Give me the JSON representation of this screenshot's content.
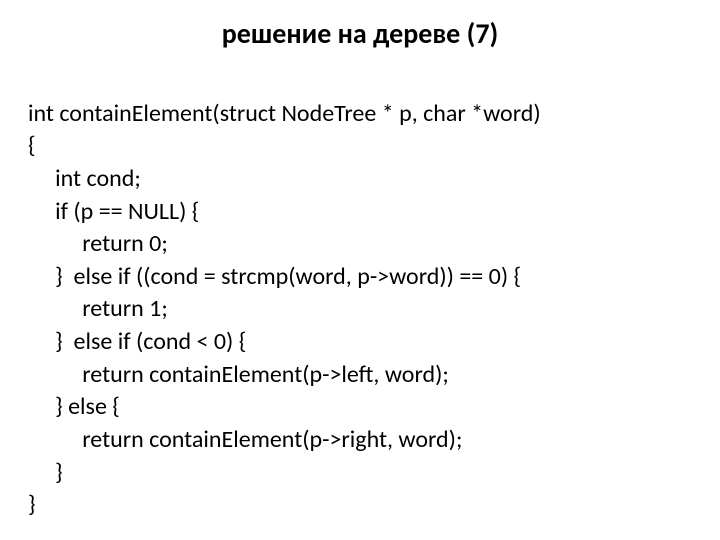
{
  "title": "решение на дереве (7)",
  "code": {
    "l01": "int containElement(struct NodeTree * p, char *word)",
    "l02": "{",
    "l03": "     int cond;",
    "l04": "     if (p == NULL) {",
    "l05": "          return 0;",
    "l06": "     }  else if ((cond = strcmp(word, p->word)) == 0) {",
    "l07": "          return 1;",
    "l08": "     }  else if (cond < 0) {",
    "l09": "          return containElement(p->left, word);",
    "l10": "     } else {",
    "l11": "          return containElement(p->right, word);",
    "l12": "     }",
    "l13": "}"
  }
}
